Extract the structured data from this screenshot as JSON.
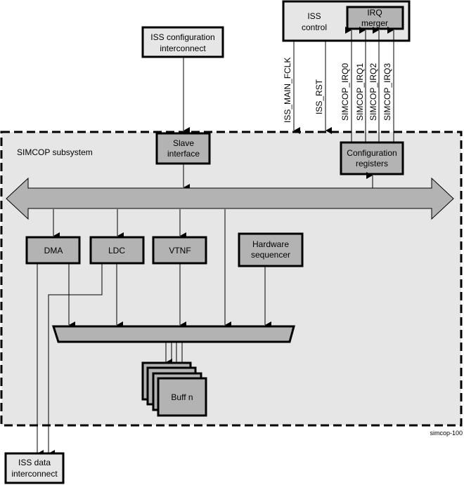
{
  "diagram": {
    "figure_id": "simcop-100",
    "subsystem_label": "SIMCOP subsystem",
    "external_blocks": {
      "iss_config_interconnect": [
        "ISS configuration",
        "interconnect"
      ],
      "iss_control": [
        "ISS",
        "control"
      ],
      "irq_merger": [
        "IRQ",
        "merger"
      ],
      "iss_data_interconnect": [
        "ISS data",
        "interconnect"
      ]
    },
    "internal_blocks": {
      "slave_interface": [
        "Slave",
        "interface"
      ],
      "config_registers": [
        "Configuration",
        "registers"
      ],
      "dma": "DMA",
      "ldc": "LDC",
      "vtnf": "VTNF",
      "hw_sequencer": [
        "Hardware",
        "sequencer"
      ],
      "buffer": "Buff n"
    },
    "signals": {
      "clk": "ISS_MAIN_FCLK",
      "rst": "ISS_RST",
      "irq": [
        "SIMCOP_IRQ0",
        "SIMCOP_IRQ1",
        "SIMCOP_IRQ2",
        "SIMCOP_IRQ3"
      ]
    },
    "colors": {
      "block_fill": "#b3b3b3",
      "external_fill": "#e6e6e6",
      "subsystem_fill": "#e6e6e6",
      "line": "#000000"
    }
  }
}
